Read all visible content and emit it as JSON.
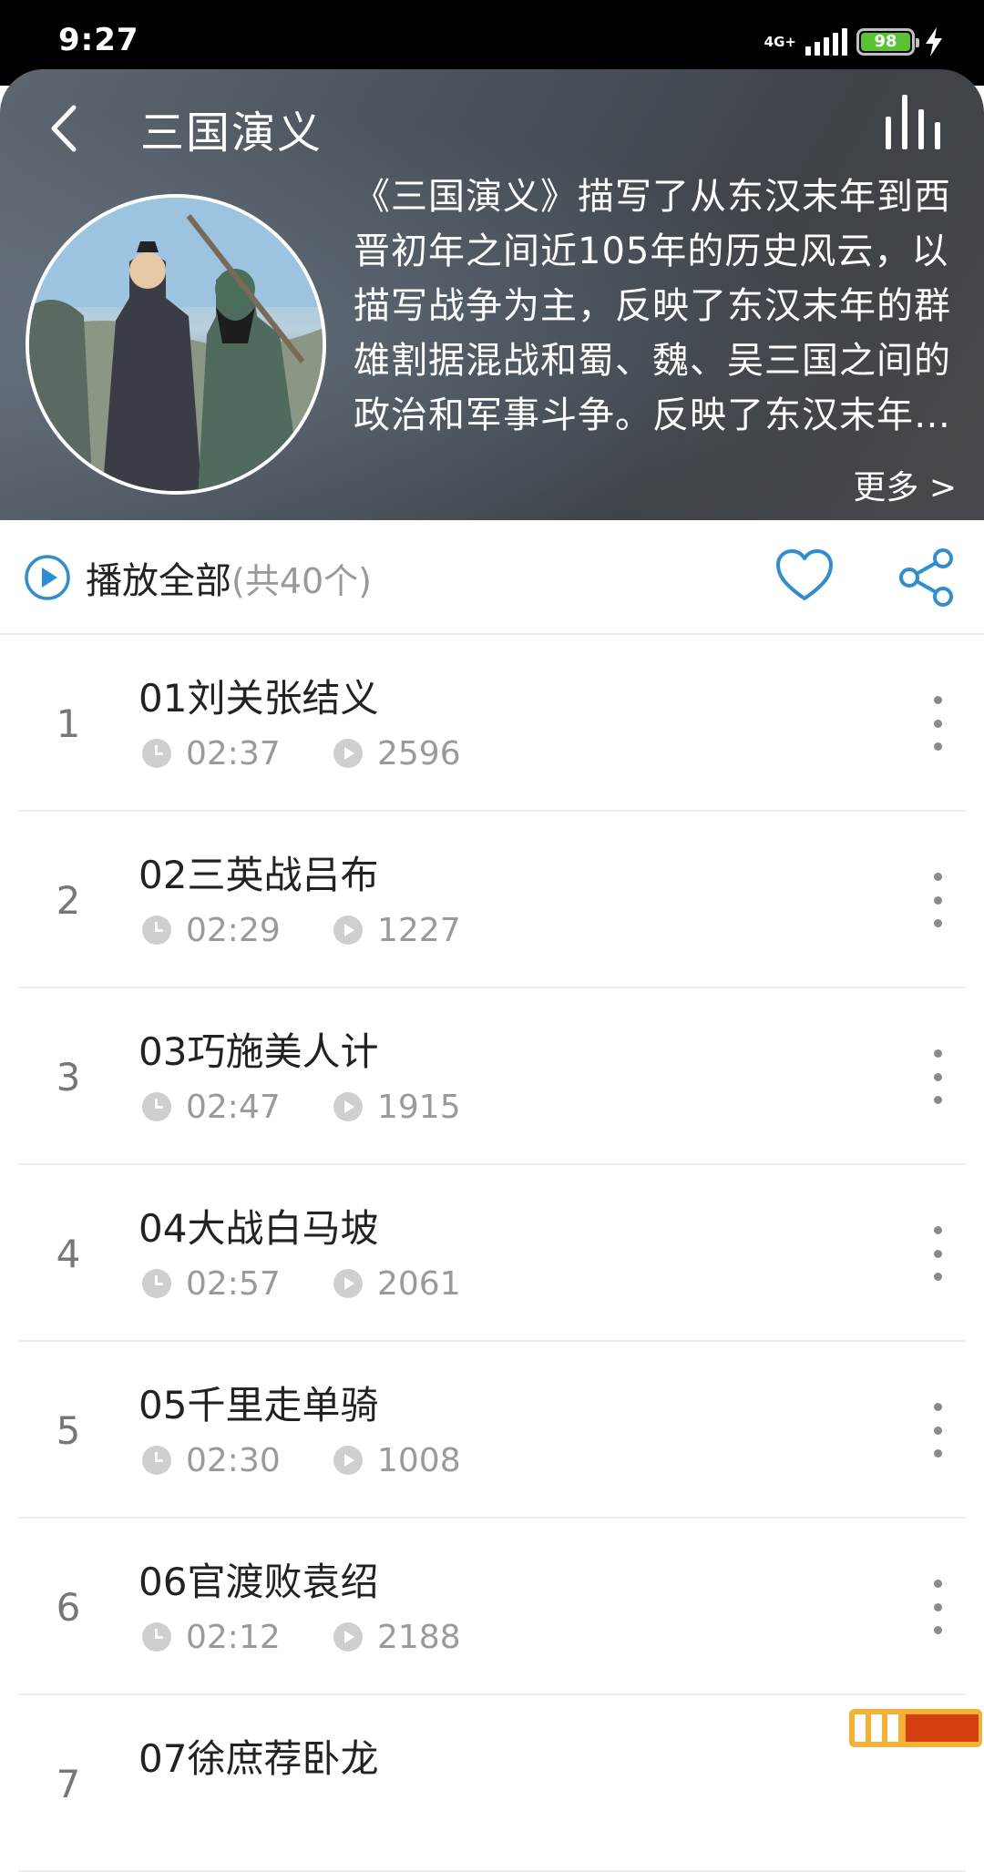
{
  "status_bar": {
    "time": "9:27",
    "network": "4G+",
    "battery": "98"
  },
  "header": {
    "title": "三国演义",
    "description": "《三国演义》描写了从东汉末年到西晋初年之间近105年的历史风云，以描写战争为主，反映了东汉末年的群雄割据混战和蜀、魏、吴三国之间的政治和军事斗争。反映了东汉末年的群雄割据混战和蜀、魏、吴三国之间的政治和军事斗争。",
    "more": "更多 >"
  },
  "play_all": {
    "label": "播放全部",
    "count": "(共40个)"
  },
  "tracks": [
    {
      "index": "1",
      "title": "01刘关张结义",
      "duration": "02:37",
      "plays": "2596"
    },
    {
      "index": "2",
      "title": "02三英战吕布",
      "duration": "02:29",
      "plays": "1227"
    },
    {
      "index": "3",
      "title": "03巧施美人计",
      "duration": "02:47",
      "plays": "1915"
    },
    {
      "index": "4",
      "title": "04大战白马坡",
      "duration": "02:57",
      "plays": "2061"
    },
    {
      "index": "5",
      "title": "05千里走单骑",
      "duration": "02:30",
      "plays": "1008"
    },
    {
      "index": "6",
      "title": "06官渡败袁绍",
      "duration": "02:12",
      "plays": "2188"
    },
    {
      "index": "7",
      "title": "07徐庶荐卧龙",
      "duration": "",
      "plays": ""
    }
  ],
  "colors": {
    "accent": "#2c8fd6",
    "header_bg": "#4b545d",
    "battery": "#58c431"
  },
  "icons": [
    "back-icon",
    "equalizer-icon",
    "play-circle-icon",
    "heart-icon",
    "share-icon",
    "clock-icon",
    "play-count-icon",
    "more-vertical-icon"
  ]
}
